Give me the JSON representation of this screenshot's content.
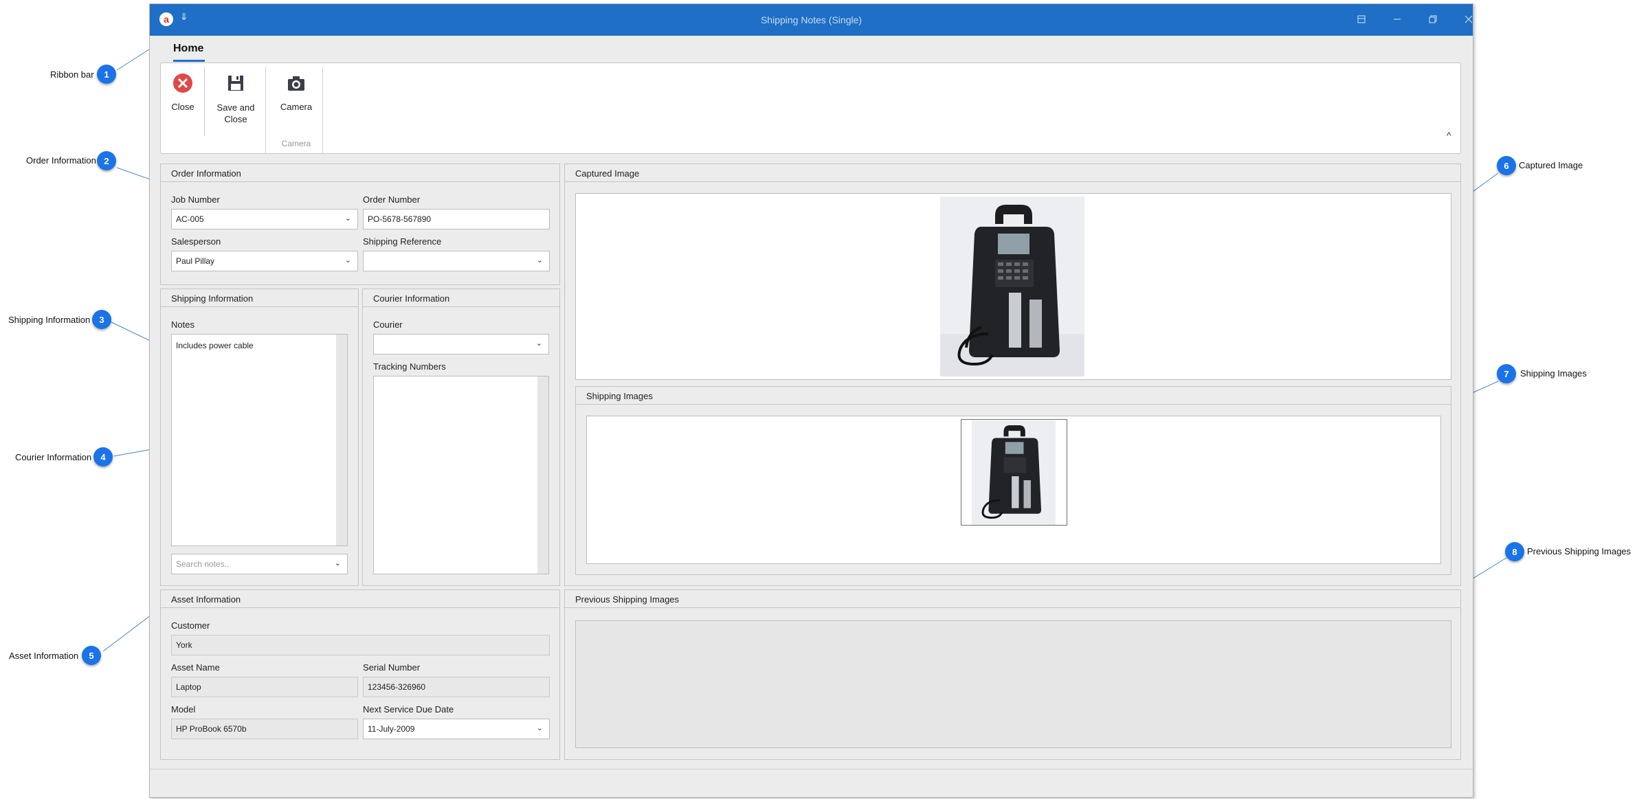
{
  "callouts": [
    {
      "num": "1",
      "label": "Ribbon bar"
    },
    {
      "num": "2",
      "label": "Order Information"
    },
    {
      "num": "3",
      "label": "Shipping Information"
    },
    {
      "num": "4",
      "label": "Courier Information"
    },
    {
      "num": "5",
      "label": "Asset Information"
    },
    {
      "num": "6",
      "label": "Captured Image"
    },
    {
      "num": "7",
      "label": "Shipping Images"
    },
    {
      "num": "8",
      "label": "Previous Shipping Images"
    }
  ],
  "window": {
    "title": "Shipping Notes (Single)",
    "logo": "a",
    "quick_access": "⇓"
  },
  "ribbon": {
    "tab": "Home",
    "close_label": "Close",
    "save_close_label_1": "Save and",
    "save_close_label_2": "Close",
    "camera_label": "Camera",
    "camera_group": "Camera",
    "collapse": "^"
  },
  "order": {
    "title": "Order Information",
    "job_number_label": "Job Number",
    "job_number": "AC-005",
    "order_number_label": "Order Number",
    "order_number": "PO-5678-567890",
    "salesperson_label": "Salesperson",
    "salesperson": "Paul Pillay",
    "shipping_reference_label": "Shipping Reference",
    "shipping_reference": ""
  },
  "shipping": {
    "title": "Shipping Information",
    "notes_label": "Notes",
    "notes": "Includes power cable",
    "search_placeholder": "Search notes.."
  },
  "courier": {
    "title": "Courier Information",
    "courier_label": "Courier",
    "courier": "",
    "tracking_label": "Tracking Numbers",
    "tracking": ""
  },
  "asset": {
    "title": "Asset Information",
    "customer_label": "Customer",
    "customer": "York",
    "asset_name_label": "Asset Name",
    "asset_name": "Laptop",
    "serial_label": "Serial Number",
    "serial": "123456-326960",
    "model_label": "Model",
    "model": "HP ProBook 6570b",
    "due_label": "Next Service Due Date",
    "due": "11-July-2009"
  },
  "captured": {
    "title": "Captured Image"
  },
  "shipping_images": {
    "title": "Shipping Images"
  },
  "previous_images": {
    "title": "Previous Shipping Images"
  },
  "colors": {
    "titlebar": "#1e6fc5",
    "badge": "#1a73e8",
    "close_red": "#e04848"
  }
}
